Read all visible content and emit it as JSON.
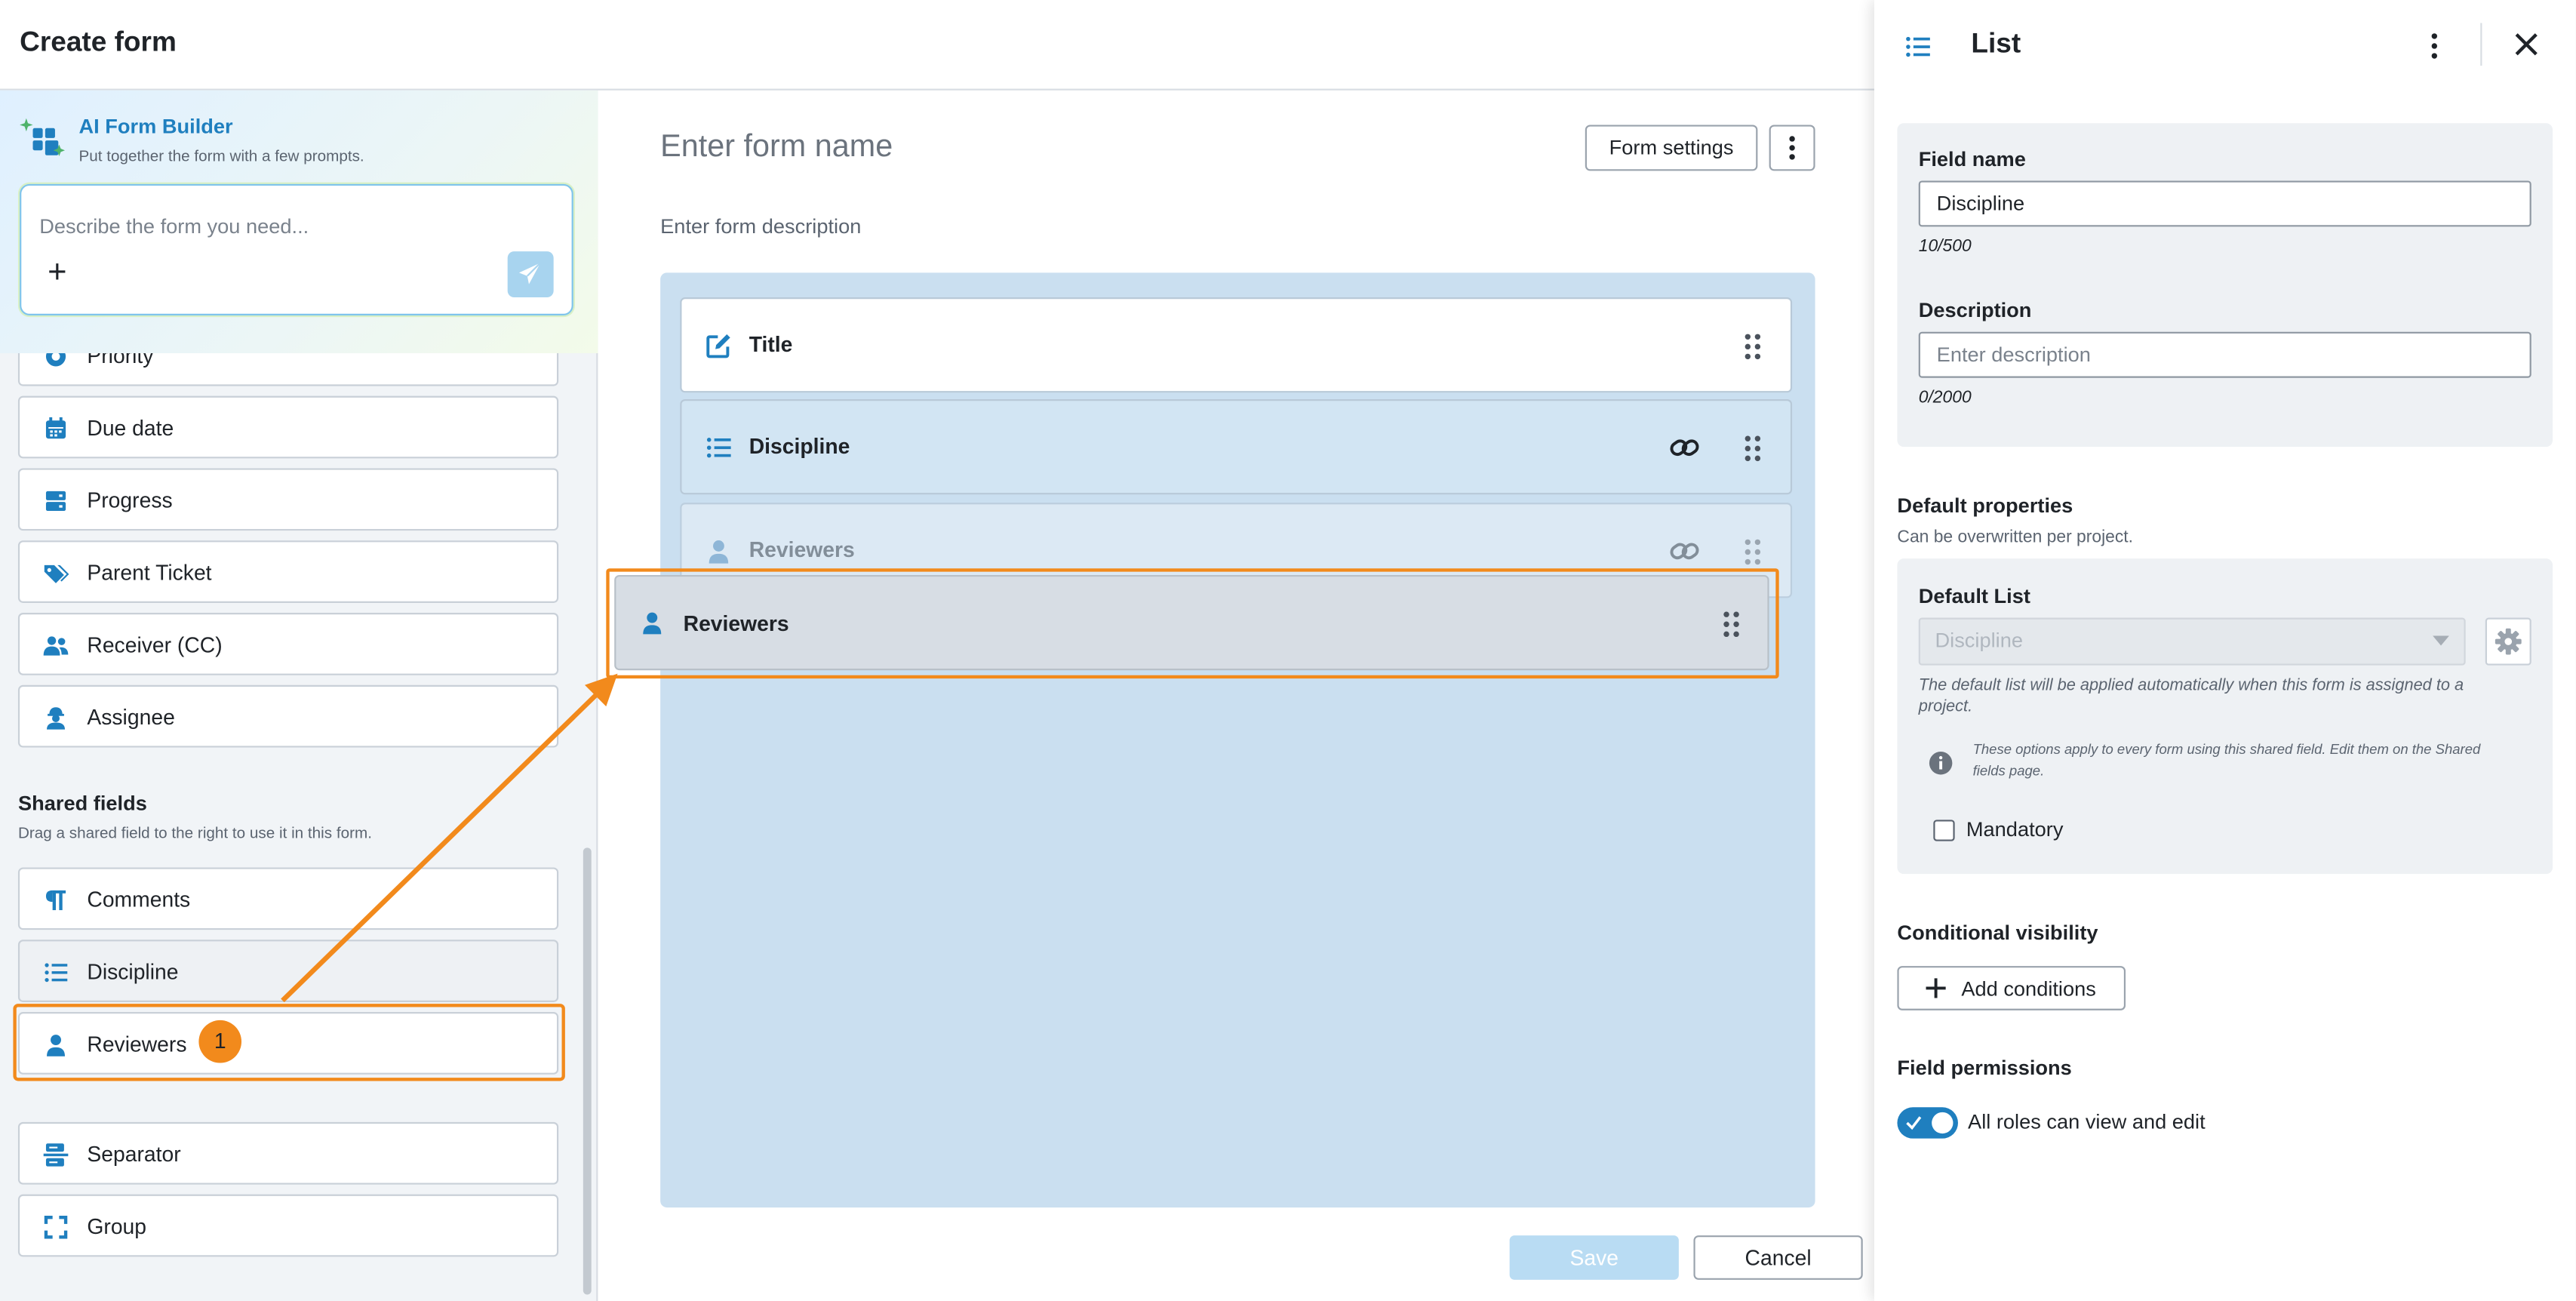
{
  "header": {
    "title": "Create form"
  },
  "ai_builder": {
    "title": "AI Form Builder",
    "subtitle": "Put together the form with a few prompts.",
    "placeholder": "Describe the form you need...",
    "add_symbol": "+"
  },
  "system_fields": [
    {
      "label": "Priority",
      "icon": "priority-icon"
    },
    {
      "label": "Due date",
      "icon": "calendar-icon"
    },
    {
      "label": "Progress",
      "icon": "progress-icon"
    },
    {
      "label": "Parent Ticket",
      "icon": "tags-icon"
    },
    {
      "label": "Receiver (CC)",
      "icon": "users-icon"
    },
    {
      "label": "Assignee",
      "icon": "worker-icon"
    }
  ],
  "shared_fields": {
    "title": "Shared fields",
    "subtitle": "Drag a shared field to the right to use it in this form.",
    "items": [
      {
        "label": "Comments",
        "icon": "paragraph-icon"
      },
      {
        "label": "Discipline",
        "icon": "list-icon"
      },
      {
        "label": "Reviewers",
        "icon": "person-icon"
      }
    ]
  },
  "layout_fields": [
    {
      "label": "Separator",
      "icon": "separator-icon"
    },
    {
      "label": "Group",
      "icon": "group-icon"
    }
  ],
  "annotation": {
    "step": "1",
    "color": "#f28a1c"
  },
  "form": {
    "name_placeholder": "Enter form name",
    "description_placeholder": "Enter form description",
    "settings_label": "Form settings",
    "fields": [
      {
        "label": "Title",
        "icon": "edit-icon"
      },
      {
        "label": "Discipline",
        "icon": "list-icon",
        "linked": true
      },
      {
        "label": "Reviewers",
        "icon": "person-icon",
        "linked": true
      }
    ],
    "dragging_label": "Reviewers",
    "save_label": "Save",
    "cancel_label": "Cancel"
  },
  "properties_panel": {
    "title": "List",
    "field_name_label": "Field name",
    "field_name_value": "Discipline",
    "field_name_count": "10/500",
    "description_label": "Description",
    "description_placeholder": "Enter description",
    "description_count": "0/2000",
    "default_props_title": "Default properties",
    "default_props_sub": "Can be overwritten per project.",
    "default_list_label": "Default List",
    "default_list_value": "Discipline",
    "default_list_note": "The default list will be applied automatically when this form is assigned to a project.",
    "shared_note": "These options apply to every form using this shared field. Edit them on the Shared fields page.",
    "mandatory_label": "Mandatory",
    "mandatory_checked": false,
    "conditional_title": "Conditional visibility",
    "add_conditions_label": "Add conditions",
    "permissions_title": "Field permissions",
    "permissions_label": "All roles can view and edit",
    "permissions_enabled": true
  },
  "colors": {
    "accent": "#1f7fbf",
    "highlight": "#f28a1c",
    "canvas": "#cadff0"
  }
}
